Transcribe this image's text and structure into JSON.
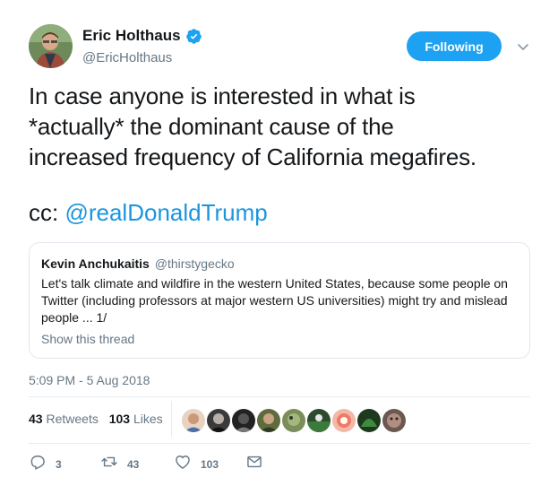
{
  "author": {
    "display_name": "Eric Holthaus",
    "handle": "@EricHolthaus",
    "avatar_icon": "profile-photo",
    "verified_icon": "verified-badge-icon"
  },
  "follow_button": {
    "label": "Following",
    "color": "#1da1f2"
  },
  "tweet": {
    "text_lines": [
      "In case anyone is interested in what is",
      "*actually* the dominant cause of the",
      "increased frequency of California megafires."
    ],
    "cc_prefix": "cc: ",
    "mention": "@realDonaldTrump"
  },
  "quoted_tweet": {
    "name": "Kevin Anchukaitis",
    "handle": "@thirstygecko",
    "body_lines": [
      "Let's talk climate and wildfire in the western United States, because some people on",
      "Twitter (including professors at major western US universities) might try and mislead",
      "people ... 1/"
    ],
    "show_thread": "Show this thread"
  },
  "timestamp": "5:09 PM - 5 Aug 2018",
  "stats": {
    "retweets": {
      "count": "43",
      "label": "Retweets"
    },
    "likes": {
      "count": "103",
      "label": "Likes"
    }
  },
  "likers_count_shown": 9,
  "actions": {
    "reply": {
      "icon": "reply-icon",
      "count": "3"
    },
    "retweet": {
      "icon": "retweet-icon",
      "count": "43"
    },
    "like": {
      "icon": "heart-icon",
      "count": "103"
    },
    "message": {
      "icon": "envelope-icon"
    }
  },
  "colors": {
    "link": "#1b95e0",
    "secondary_text": "#657786",
    "primary_text": "#14171a",
    "border": "#e1e8ed"
  }
}
